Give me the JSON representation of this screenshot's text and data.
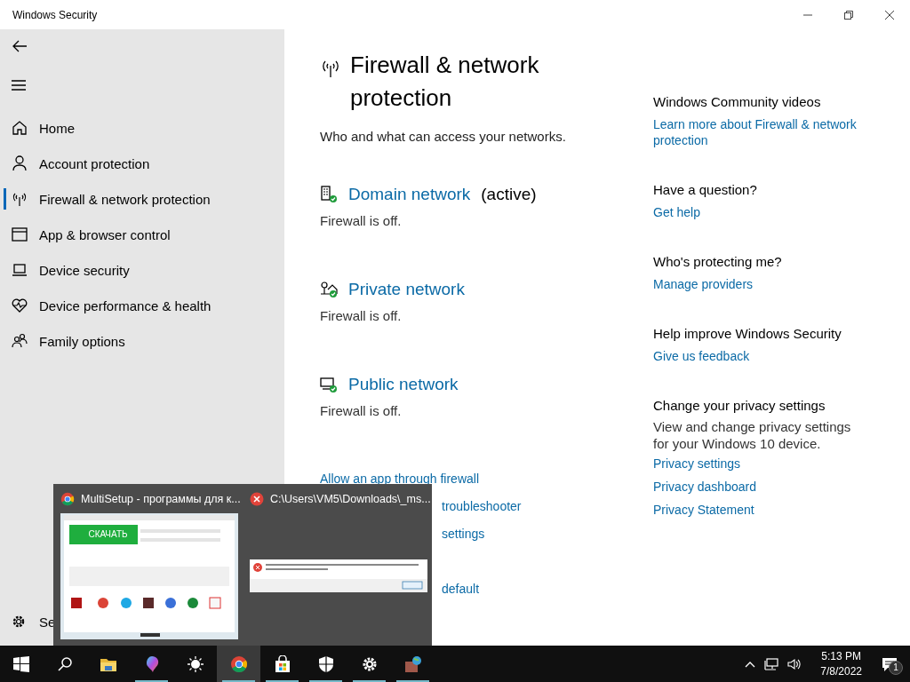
{
  "window": {
    "title": "Windows Security"
  },
  "sidebar": {
    "items": [
      {
        "label": "Home",
        "kind": "home",
        "selected": false
      },
      {
        "label": "Account protection",
        "kind": "account",
        "selected": false
      },
      {
        "label": "Firewall & network protection",
        "kind": "firewall",
        "selected": true
      },
      {
        "label": "App & browser control",
        "kind": "app",
        "selected": false
      },
      {
        "label": "Device security",
        "kind": "device",
        "selected": false
      },
      {
        "label": "Device performance & health",
        "kind": "health",
        "selected": false
      },
      {
        "label": "Family options",
        "kind": "family",
        "selected": false
      }
    ],
    "footer": {
      "label": "Se"
    }
  },
  "page": {
    "title": "Firewall & network protection",
    "subtitle": "Who and what can access your networks.",
    "networks": [
      {
        "kind": "domain",
        "name": "Domain network",
        "tag": "(active)",
        "status": "Firewall is off."
      },
      {
        "kind": "private",
        "name": "Private network",
        "status": "Firewall is off."
      },
      {
        "kind": "public",
        "name": "Public network",
        "status": "Firewall is off."
      }
    ],
    "links": [
      {
        "kind": "whole",
        "text": "Allow an app through firewall"
      },
      {
        "kind": "cut",
        "text": "troubleshooter"
      },
      {
        "kind": "cut",
        "text": "settings"
      },
      {
        "kind": "tail",
        "text": "default"
      }
    ]
  },
  "related": [
    {
      "heading": "Windows Community videos",
      "links": [
        "Learn more about Firewall & network protection"
      ]
    },
    {
      "heading": "Have a question?",
      "links": [
        "Get help"
      ]
    },
    {
      "heading": "Who's protecting me?",
      "links": [
        "Manage providers"
      ]
    },
    {
      "heading": "Help improve Windows Security",
      "links": [
        "Give us feedback"
      ]
    },
    {
      "heading": "Change your privacy settings",
      "text": "View and change privacy settings for your Windows 10 device.",
      "links": [
        "Privacy settings",
        "Privacy dashboard",
        "Privacy Statement"
      ]
    }
  ],
  "taskbar": {
    "apps": [
      {
        "kind": "search",
        "running": false,
        "selected": false
      },
      {
        "kind": "folder",
        "running": false,
        "selected": false
      },
      {
        "kind": "paint",
        "running": true,
        "selected": false
      },
      {
        "kind": "sun",
        "running": false,
        "selected": false
      },
      {
        "kind": "browser",
        "running": true,
        "selected": true
      },
      {
        "kind": "store",
        "running": true,
        "selected": false
      },
      {
        "kind": "shield",
        "running": true,
        "selected": false
      },
      {
        "kind": "gear",
        "running": true,
        "selected": false
      },
      {
        "kind": "globe",
        "running": true,
        "selected": false
      }
    ],
    "time": "5:13 PM",
    "date": "7/8/2022",
    "notifications": "1"
  },
  "peek": {
    "windows": [
      {
        "kind": "browser",
        "title": "MultiSetup - программы для к...",
        "button": "СКАЧАТЬ"
      },
      {
        "kind": "error",
        "title": "C:\\Users\\VM5\\Downloads\\_ms..."
      }
    ]
  }
}
